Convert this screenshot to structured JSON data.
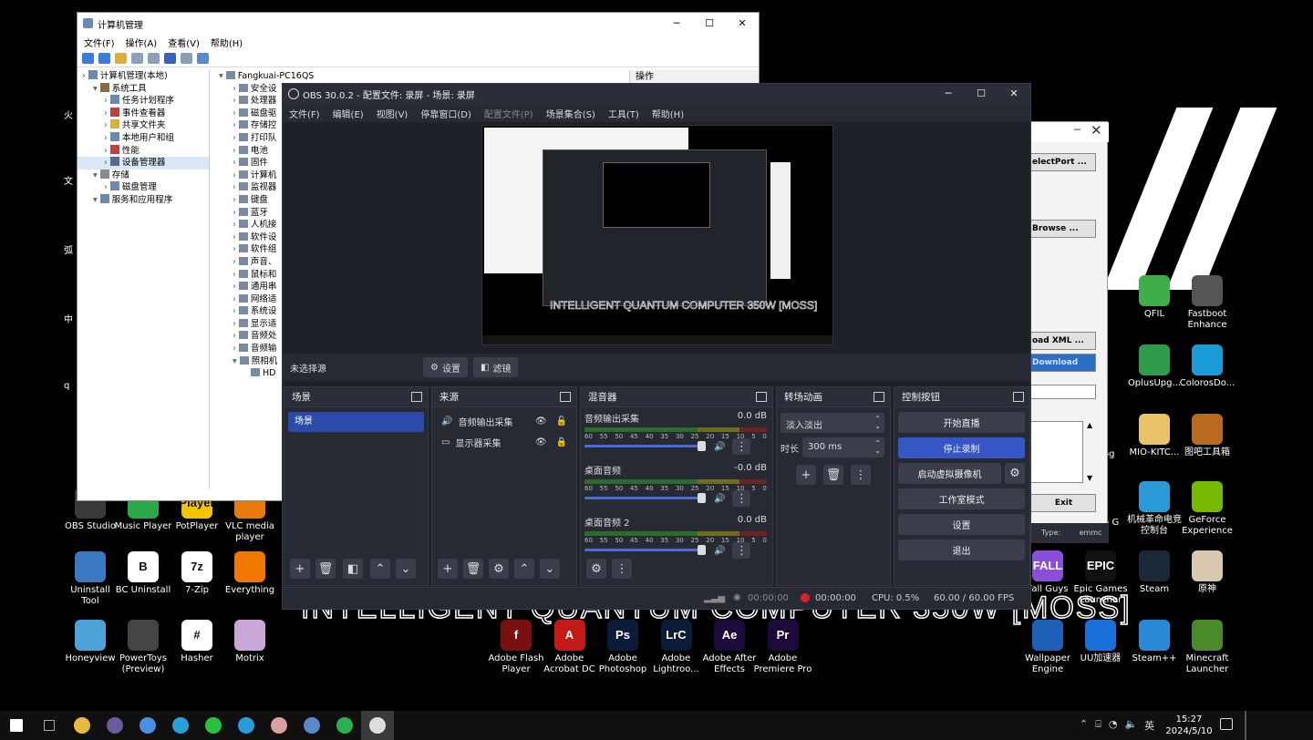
{
  "desktop": {
    "big_text": "INTELLIGENT QUANTUM COMPUTER 350W [MOSS]",
    "left_edge_labels": [
      "火",
      "文",
      "弧",
      "中",
      "q"
    ],
    "icons_left": [
      {
        "label": "OBS Studio",
        "icon": "obs-icon",
        "color": "#3a3a3a"
      },
      {
        "label": "Music Player",
        "icon": "music-player-icon",
        "color": "#2aa84a"
      },
      {
        "label": "PotPlayer",
        "icon": "potplayer-icon",
        "color": "#f5c400",
        "text": "Player"
      },
      {
        "label": "VLC media player",
        "icon": "vlc-icon",
        "color": "#e87b0c"
      },
      {
        "label": "Uninstall Tool",
        "icon": "uninstall-tool-icon",
        "color": "#3a78c2"
      },
      {
        "label": "BC Uninstall",
        "icon": "bc-uninstall-icon",
        "color": "#ffffff",
        "text": "B"
      },
      {
        "label": "7-Zip",
        "icon": "7zip-icon",
        "color": "#ffffff",
        "text": "7z"
      },
      {
        "label": "Everything",
        "icon": "everything-icon",
        "color": "#f07800"
      },
      {
        "label": "Honeyview",
        "icon": "honeyview-icon",
        "color": "#4da3d8"
      },
      {
        "label": "PowerToys (Preview)",
        "icon": "powertoys-icon",
        "color": "#444"
      },
      {
        "label": "Hasher",
        "icon": "hasher-icon",
        "color": "#ffffff",
        "text": "#"
      },
      {
        "label": "Motrix",
        "icon": "motrix-icon",
        "color": "#c9a7d8"
      }
    ],
    "icons_middle": [
      {
        "label": "Adobe Flash Player",
        "icon": "flash-icon",
        "color": "#7a1010",
        "text": "f"
      },
      {
        "label": "Adobe Acrobat DC",
        "icon": "acrobat-icon",
        "color": "#c21b17",
        "text": "A"
      },
      {
        "label": "Adobe Photoshop",
        "icon": "photoshop-icon",
        "color": "#0a1c3a",
        "text": "Ps"
      },
      {
        "label": "Adobe Lightroo...",
        "icon": "lightroom-icon",
        "color": "#0a1c3a",
        "text": "LrC"
      },
      {
        "label": "Adobe After Effects",
        "icon": "after-effects-icon",
        "color": "#1c0b3a",
        "text": "Ae"
      },
      {
        "label": "Adobe Premiere Pro",
        "icon": "premiere-icon",
        "color": "#1c0b3a",
        "text": "Pr"
      }
    ],
    "icons_right": [
      {
        "label": "QFIL",
        "icon": "qfil-icon",
        "color": "#3fae49"
      },
      {
        "label": "Fastboot Enhance",
        "icon": "fastboot-icon",
        "color": "#555"
      },
      {
        "label": "OplusUpg...",
        "icon": "oplus-icon",
        "color": "#2e9a4a"
      },
      {
        "label": "ColorosDo...",
        "icon": "coloros-icon",
        "color": "#1a9bd6"
      },
      {
        "label": "MIO-KITC...",
        "icon": "folder-icon",
        "color": "#e8c36a"
      },
      {
        "label": "图吧工具箱",
        "icon": "toolbox-icon",
        "color": "#b86a20"
      },
      {
        "label": "机械革命电竞控制台",
        "icon": "mechrevo-icon",
        "color": "#2a9bd6"
      },
      {
        "label": "GeForce Experience",
        "icon": "geforce-icon",
        "color": "#76b900"
      },
      {
        "label": "Fall Guys",
        "icon": "fall-guys-icon",
        "color": "#8a4fd8",
        "text": "FALL"
      },
      {
        "label": "Epic Games Launcher",
        "icon": "epic-icon",
        "color": "#111",
        "text": "EPIC"
      },
      {
        "label": "Steam",
        "icon": "steam-icon",
        "color": "#1b2838"
      },
      {
        "label": "原神",
        "icon": "genshin-icon",
        "color": "#d8c8b0"
      },
      {
        "label": "Wallpaper Engine",
        "icon": "wallpaper-engine-icon",
        "color": "#1e5fb8"
      },
      {
        "label": "UU加速器",
        "icon": "uu-icon",
        "color": "#1a6fd8"
      },
      {
        "label": "Steam++",
        "icon": "steampp-icon",
        "color": "#2a8ad8"
      },
      {
        "label": "Minecraft Launcher",
        "icon": "minecraft-icon",
        "color": "#4a8a2a"
      }
    ],
    "partial_labels": [
      "og",
      "h G",
      "3"
    ]
  },
  "computer_management": {
    "title": "计算机管理",
    "menu": [
      "文件(F)",
      "操作(A)",
      "查看(V)",
      "帮助(H)"
    ],
    "tree": [
      "计算机管理(本地)",
      "系统工具",
      "任务计划程序",
      "事件查看器",
      "共享文件夹",
      "本地用户和组",
      "性能",
      "设备管理器",
      "存储",
      "磁盘管理",
      "服务和应用程序"
    ],
    "devices": [
      "Fangkuai-PC16QS",
      "安全设",
      "处理器",
      "磁盘驱",
      "存储控",
      "打印队",
      "电池",
      "固件",
      "计算机",
      "监视器",
      "键盘",
      "蓝牙",
      "人机接",
      "软件设",
      "软件组",
      "声音、",
      "鼠标和",
      "通用串",
      "网络适",
      "系统设",
      "显示适",
      "音频处",
      "音频输",
      "照相机",
      "HD"
    ],
    "ops_title": "操作"
  },
  "obs": {
    "title": "OBS 30.0.2 - 配置文件: 录屏 - 场景: 录屏",
    "menu": [
      {
        "label": "文件(F)",
        "enabled": true
      },
      {
        "label": "编辑(E)",
        "enabled": true
      },
      {
        "label": "视图(V)",
        "enabled": true
      },
      {
        "label": "停靠窗口(D)",
        "enabled": true
      },
      {
        "label": "配置文件(P)",
        "enabled": false
      },
      {
        "label": "场景集合(S)",
        "enabled": true
      },
      {
        "label": "工具(T)",
        "enabled": true
      },
      {
        "label": "帮助(H)",
        "enabled": true
      }
    ],
    "no_source": "未选择源",
    "properties_btn": "设置",
    "filters_btn": "滤镜",
    "scenes": {
      "title": "场景",
      "items": [
        "场景"
      ]
    },
    "sources": {
      "title": "来源",
      "items": [
        {
          "name": "音频输出采集",
          "icon": "speaker-icon"
        },
        {
          "name": "显示器采集",
          "icon": "monitor-icon"
        }
      ]
    },
    "mixer": {
      "title": "混音器",
      "scale": [
        "60",
        "55",
        "50",
        "45",
        "40",
        "35",
        "30",
        "25",
        "20",
        "15",
        "10",
        "5",
        "0"
      ],
      "channels": [
        {
          "name": "音频输出采集",
          "db": "0.0 dB",
          "level": 0.95
        },
        {
          "name": "桌面音频",
          "db": "-0.0 dB",
          "level": 0.95
        },
        {
          "name": "桌面音频 2",
          "db": "0.0 dB",
          "level": 0.95
        }
      ]
    },
    "transitions": {
      "title": "转场动画",
      "type": "淡入淡出",
      "duration_label": "时长",
      "duration": "300 ms"
    },
    "controls": {
      "title": "控制按钮",
      "start_stream": "开始直播",
      "stop_record": "停止录制",
      "virtual_cam": "启动虚拟摄像机",
      "studio_mode": "工作室模式",
      "settings": "设置",
      "exit": "退出"
    },
    "status": {
      "stream_time": "00:00:00",
      "record_time": "00:00:00",
      "cpu": "CPU: 0.5%",
      "fps": "60.00 / 60.00 FPS"
    },
    "preview_text": "INTELLIGENT QUANTUM COMPUTER 350W [MOSS]"
  },
  "tool_window": {
    "buttons": [
      "electPort ...",
      "Browse ...",
      "oad XML ...",
      "Download",
      "Exit"
    ],
    "type_label": "Type:",
    "type_value": "emmc"
  },
  "taskbar": {
    "time": "15:27",
    "date": "2024/5/10",
    "ime": "英",
    "apps": [
      "start-icon",
      "task-view-icon",
      "file-explorer-icon",
      "cat-app-icon",
      "chrome-icon",
      "edge-icon",
      "wechat-icon",
      "telegram-icon",
      "photo-app-icon",
      "tool-app-icon",
      "downloader-icon",
      "obs-taskbar-icon"
    ]
  }
}
